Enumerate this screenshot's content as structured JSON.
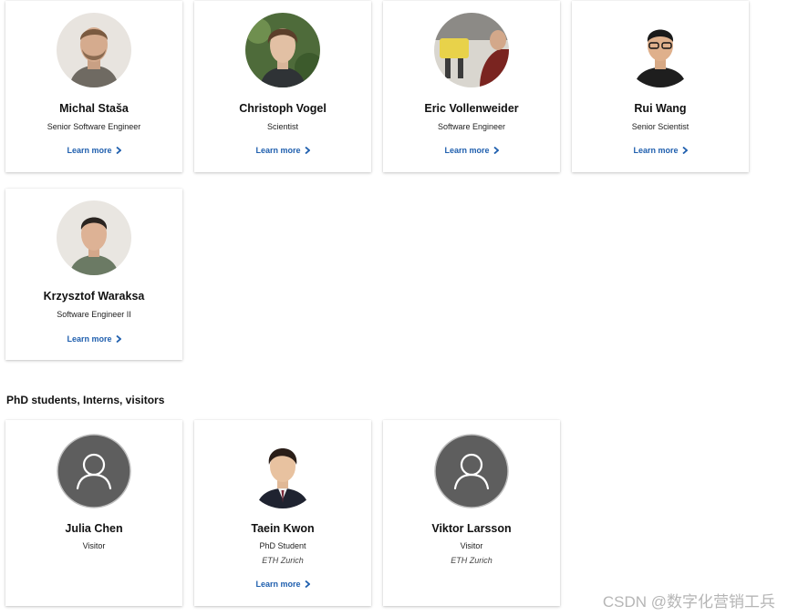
{
  "team": {
    "members": [
      {
        "name": "Michal Staša",
        "role": "Senior Software Engineer",
        "link_label": "Learn more",
        "avatar_icon": "person-photo-icon"
      },
      {
        "name": "Christoph Vogel",
        "role": "Scientist",
        "link_label": "Learn more",
        "avatar_icon": "person-photo-icon"
      },
      {
        "name": "Eric Vollenweider",
        "role": "Software Engineer",
        "link_label": "Learn more",
        "avatar_icon": "person-photo-icon"
      },
      {
        "name": "Rui Wang",
        "role": "Senior Scientist",
        "link_label": "Learn more",
        "avatar_icon": "person-photo-icon"
      },
      {
        "name": "Krzysztof Waraksa",
        "role": "Software Engineer II",
        "link_label": "Learn more",
        "avatar_icon": "person-photo-icon"
      }
    ]
  },
  "students": {
    "heading": "PhD students, Interns, visitors",
    "members": [
      {
        "name": "Julia Chen",
        "role": "Visitor",
        "avatar_icon": "default-user-icon"
      },
      {
        "name": "Taein Kwon",
        "role": "PhD Student",
        "affiliation": "ETH Zurich",
        "link_label": "Learn more",
        "avatar_icon": "person-photo-icon"
      },
      {
        "name": "Viktor Larsson",
        "role": "Visitor",
        "affiliation": "ETH Zurich",
        "avatar_icon": "default-user-icon"
      }
    ]
  },
  "watermark": "CSDN @数字化营销工兵",
  "colors": {
    "link": "#1f5fae",
    "placeholder_avatar": "#5e5e5e"
  }
}
